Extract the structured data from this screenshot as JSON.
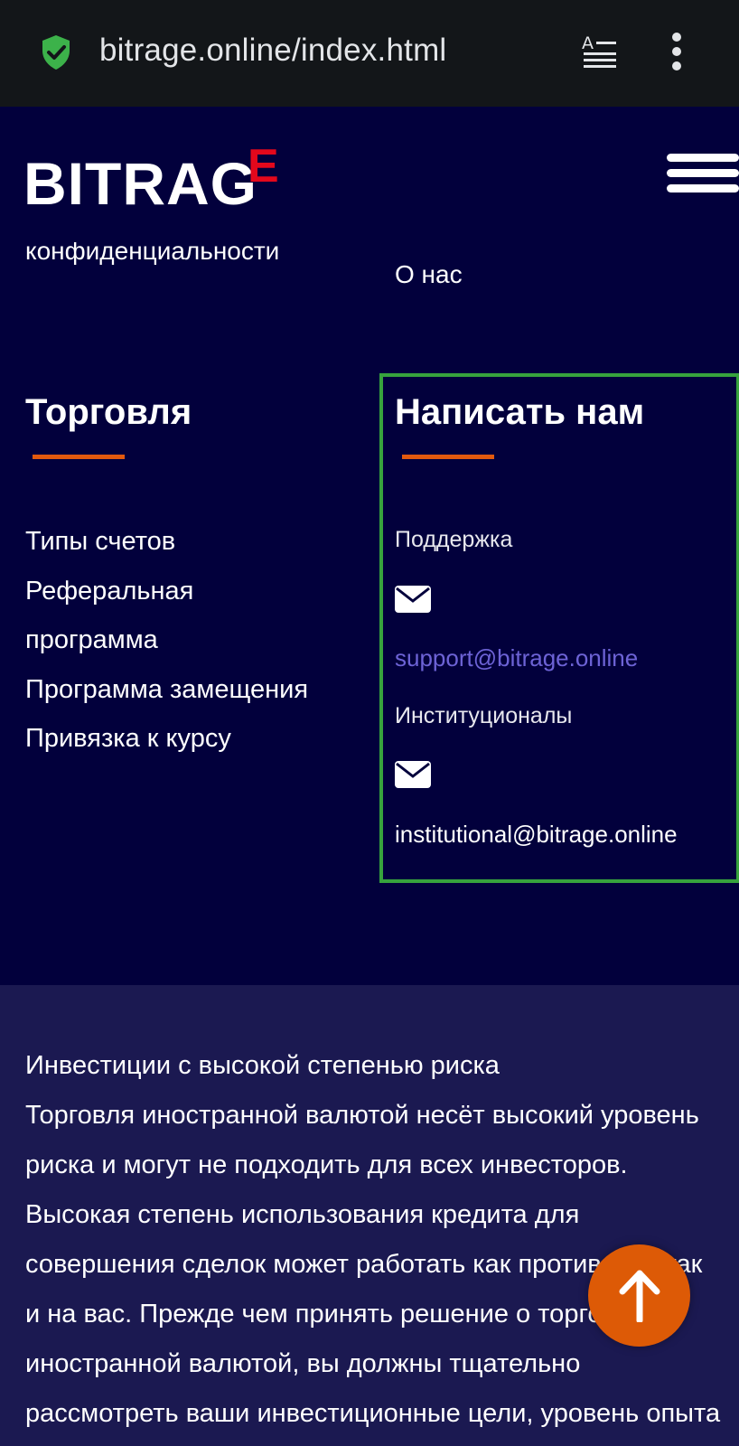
{
  "browser": {
    "url": "bitrage.online/index.html",
    "icons": [
      "shield-check-icon",
      "reader-mode-icon",
      "more-vert-icon"
    ]
  },
  "header": {
    "logo_main": "BITRAG",
    "logo_accent": "E",
    "accent_color": "#e3081c",
    "menu_icon": "hamburger-icon"
  },
  "nav": {
    "partial_link": "конфиденциальности",
    "about": "О нас"
  },
  "trading": {
    "title": "Торговля",
    "links": [
      "Типы счетов",
      "Реферальная",
      "программа",
      "Программа замещения",
      "Привязка к курсу"
    ]
  },
  "contact": {
    "title": "Написать нам",
    "support_label": "Поддержка",
    "support_email": "support@bitrage.online",
    "institutional_label": "Институционалы",
    "institutional_email": "institutional@bitrage.online",
    "email_color": "#6d63d6",
    "highlight_color": "#37a33d"
  },
  "risk": {
    "text": "Инвестиции с высокой степенью риска\n  Торговля иностранной валютой несёт высокий уровень риска и могут не подходить для всех инвесторов. Высокая степень использования кредита для совершения сделок может работать как против вас, так и на вас. Прежде чем принять решение о торговле иностранной валютой, вы должны тщательно рассмотреть ваши инвестиционные цели, уровень опыта и умение"
  },
  "scroll_top": {
    "icon": "arrow-up-icon",
    "color": "#dd5a06"
  }
}
